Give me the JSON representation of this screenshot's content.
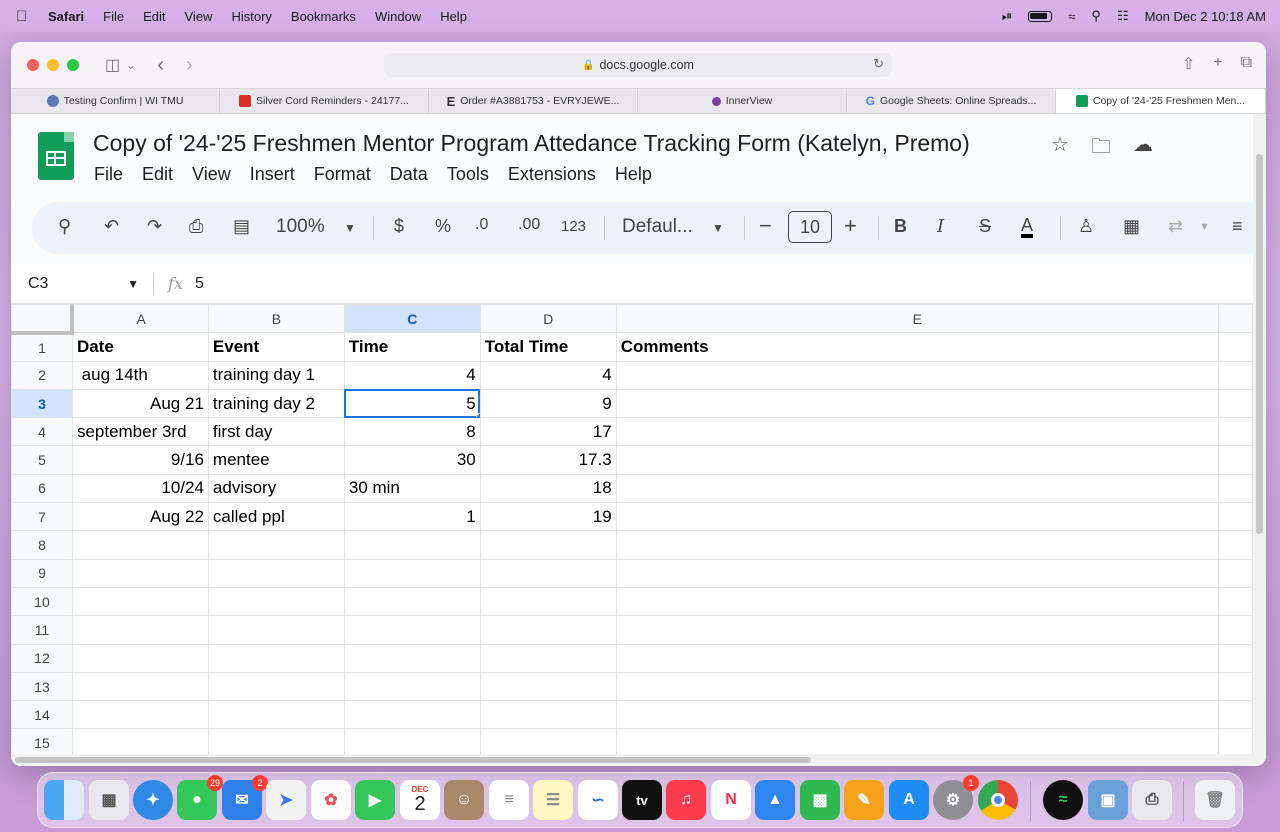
{
  "menubar": {
    "app": "Safari",
    "items": [
      "File",
      "Edit",
      "View",
      "History",
      "Bookmarks",
      "Window",
      "Help"
    ],
    "clock": "Mon Dec 2  10:18 AM"
  },
  "browser": {
    "url": "docs.google.com",
    "tabs": [
      {
        "label": "Testing Confirm | WI TMU",
        "color": "#5b7bb5"
      },
      {
        "label": "Silver Cord Reminders - 24177...",
        "color": "#d93025"
      },
      {
        "label": "Order #A3881753 - EVRYJEWE...",
        "color": "#222222"
      },
      {
        "label": "InnerView",
        "color": "#7b3fa0"
      },
      {
        "label": "Google Sheets: Online Spreads...",
        "color": "#4285f4"
      },
      {
        "label": "Copy of '24-'25 Freshmen Men...",
        "color": "#0f9d58"
      }
    ]
  },
  "sheets": {
    "title": "Copy of '24-'25 Freshmen Mentor Program Attedance Tracking Form (Katelyn,  Premo)",
    "menu": [
      "File",
      "Edit",
      "View",
      "Insert",
      "Format",
      "Data",
      "Tools",
      "Extensions",
      "Help"
    ],
    "toolbar": {
      "zoom": "100%",
      "currency": "$",
      "percent": "%",
      "dec_decrease": ".0",
      "dec_increase": ".00",
      "number_format": "123",
      "font": "Defaul...",
      "font_size": "10"
    },
    "name_box": "C3",
    "formula_value": "5",
    "columns": [
      "A",
      "B",
      "C",
      "D",
      "E"
    ],
    "rows": [
      {
        "n": "1",
        "a": "Date",
        "b": "Event",
        "c": "Time",
        "d": "Total Time",
        "e": "Comments"
      },
      {
        "n": "2",
        "a": " aug 14th",
        "b": "training day 1",
        "c": "4",
        "d": "4",
        "e": ""
      },
      {
        "n": "3",
        "a": "Aug 21",
        "b": "training day 2",
        "c": "5",
        "d": "9",
        "e": ""
      },
      {
        "n": "4",
        "a": "september 3rd",
        "b": "first day",
        "c": "8",
        "d": "17",
        "e": ""
      },
      {
        "n": "5",
        "a": "9/16",
        "b": "mentee",
        "c": "30",
        "d": "17.3",
        "e": ""
      },
      {
        "n": "6",
        "a": "10/24",
        "b": "advisory",
        "c": "30 min",
        "d": "18",
        "e": ""
      },
      {
        "n": "7",
        "a": "Aug 22",
        "b": "called ppl",
        "c": "1",
        "d": "19",
        "e": ""
      },
      {
        "n": "8",
        "a": "",
        "b": "",
        "c": "",
        "d": "",
        "e": ""
      },
      {
        "n": "9",
        "a": "",
        "b": "",
        "c": "",
        "d": "",
        "e": ""
      },
      {
        "n": "10",
        "a": "",
        "b": "",
        "c": "",
        "d": "",
        "e": ""
      },
      {
        "n": "11",
        "a": "",
        "b": "",
        "c": "",
        "d": "",
        "e": ""
      },
      {
        "n": "12",
        "a": "",
        "b": "",
        "c": "",
        "d": "",
        "e": ""
      },
      {
        "n": "13",
        "a": "",
        "b": "",
        "c": "",
        "d": "",
        "e": ""
      },
      {
        "n": "14",
        "a": "",
        "b": "",
        "c": "",
        "d": "",
        "e": ""
      },
      {
        "n": "15",
        "a": "",
        "b": "",
        "c": "",
        "d": "",
        "e": ""
      }
    ]
  },
  "dock": {
    "messages_badge": "29",
    "mail_badge": "2",
    "calendar_month": "DEC",
    "calendar_day": "2",
    "appletv_label": "tv",
    "settings_badge": "1"
  }
}
